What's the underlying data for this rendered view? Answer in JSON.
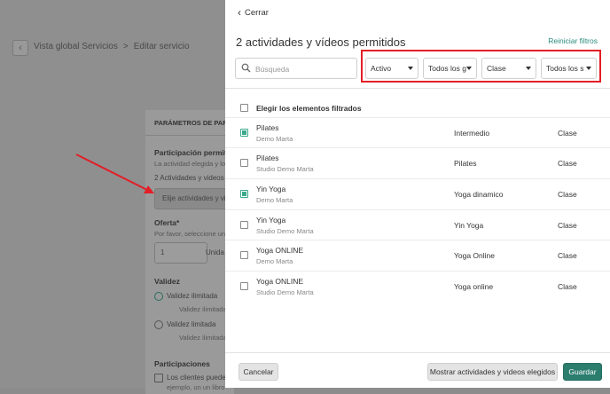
{
  "background": {
    "breadcrumb": {
      "back_icon": "chevron-left-icon",
      "items": [
        "Vista global Servicios",
        "Editar servicio"
      ],
      "separator": ">"
    },
    "card": {
      "header": "PARÁMETROS DE PARTI",
      "participation_label": "Participación permit",
      "participation_hint": "La actividad elegida y lo",
      "count_text": "2 Actividades y videos",
      "choose_button": "Elije actividades y vi",
      "offer_label": "Oferta*",
      "offer_hint": "Por favor, seleccione un",
      "offer_value": "1",
      "offer_unit": "Unida",
      "validity_label": "Validez",
      "option_limited_1": "Validez ilimitada",
      "option_limited_1_sub": "Validez ilimitada",
      "option_limited_2": "Validez limitada",
      "option_limited_2_sub": "Validez ilimitada",
      "participations_label": "Participaciones",
      "participations_text": "Los clientes puede",
      "participations_sub": "ejemplo, un un libro"
    }
  },
  "panel": {
    "close_label": "Cerrar",
    "title": "2 actividades y vídeos permitidos",
    "reset_filters": "Reiniciar filtros",
    "search": {
      "placeholder": "Búsqueda",
      "value": ""
    },
    "filters": [
      {
        "value": "Activo"
      },
      {
        "value": "Todos los g"
      },
      {
        "value": "Clase"
      },
      {
        "value": "Todos los s"
      }
    ],
    "select_all_label": "Elegir los elementos filtrados",
    "rows": [
      {
        "name": "Pilates",
        "studio": "Demo Marta",
        "level": "Intermedio",
        "type": "Clase",
        "checked": true
      },
      {
        "name": "Pilates",
        "studio": "Studio Demo Marta",
        "level": "Pilates",
        "type": "Clase",
        "checked": false
      },
      {
        "name": "Yin Yoga",
        "studio": "Demo Marta",
        "level": "Yoga dinamico",
        "type": "Clase",
        "checked": true
      },
      {
        "name": "Yin Yoga",
        "studio": "Studio Demo Marta",
        "level": "Yin Yoga",
        "type": "Clase",
        "checked": false
      },
      {
        "name": "Yoga ONLINE",
        "studio": "Demo Marta",
        "level": "Yoga Online",
        "type": "Clase",
        "checked": false
      },
      {
        "name": "Yoga ONLINE",
        "studio": "Studio Demo Marta",
        "level": "Yoga online",
        "type": "Clase",
        "checked": false
      }
    ],
    "footer": {
      "cancel": "Cancelar",
      "show_selected": "Mostrar actividades y videos elegidos",
      "save": "Guardar"
    }
  },
  "colors": {
    "accent": "#2b7d6e",
    "link": "#2b8a7c",
    "annotation_red": "#e41e26",
    "check_green": "#3aa98b"
  }
}
